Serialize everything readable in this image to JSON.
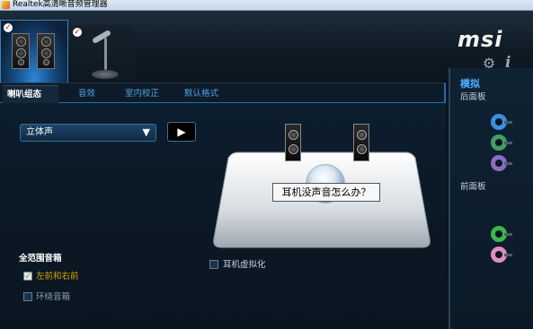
{
  "window": {
    "title": "Realtek高清晰音频管理器"
  },
  "devices": [
    {
      "name": "speakers",
      "checked": true,
      "active": true
    },
    {
      "name": "microphone",
      "checked": true,
      "active": false
    }
  ],
  "header": {
    "brand": "msi"
  },
  "tabs": [
    {
      "label": "喇叭组态",
      "active": true
    },
    {
      "label": "音效"
    },
    {
      "label": "室内校正"
    },
    {
      "label": "默认格式"
    }
  ],
  "config": {
    "speaker_mode": "立体声",
    "help_tooltip": "耳机没声音怎么办？",
    "headphone_virtualization": {
      "label": "耳机虚拟化",
      "checked": false
    },
    "full_range": {
      "title": "全范围音箱",
      "front": {
        "label": "左前和右前",
        "checked": true
      },
      "surround": {
        "label": "环绕音箱",
        "checked": false
      }
    }
  },
  "right_panel": {
    "title": "模拟",
    "back_panel": "后面板",
    "front_panel": "前面板",
    "back_jacks": [
      "#3b8fe0",
      "#3fa067",
      "#8c6bc4"
    ],
    "front_jacks": [
      "#39b94a",
      "#e38bbd"
    ]
  },
  "colors": {
    "accent": "#1d6fb1",
    "tab_text": "#4aa3e6",
    "brand_text": "#f2f2f2"
  }
}
